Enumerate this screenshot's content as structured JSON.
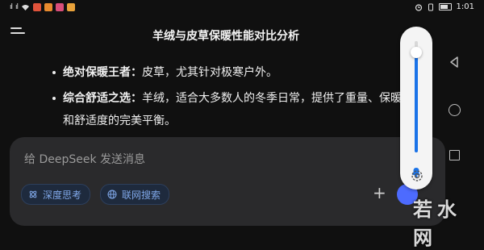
{
  "status_bar": {
    "time": "1:01",
    "signal": "ıl",
    "app_icon_colors": [
      "#e0533b",
      "#e88a2e",
      "#d94e7a",
      "#e9a23a"
    ]
  },
  "header": {
    "title": "羊绒与皮草保暖性能对比分析"
  },
  "content": {
    "bullets": [
      {
        "label": "绝对保暖王者：",
        "text": "皮草，尤其针对极寒户外。"
      },
      {
        "label": "综合舒适之选：",
        "text": "羊绒，适合大多数人的冬季日常，提供了重量、保暖和舒适度的完美平衡。"
      }
    ]
  },
  "composer": {
    "placeholder": "给 DeepSeek 发送消息",
    "deep_think_label": "深度思考",
    "web_search_label": "联网搜索"
  },
  "volume_panel": {
    "level_fraction": 0.9,
    "accent": "#1a73e8"
  },
  "watermark": {
    "text": "若水网"
  },
  "colors": {
    "background": "#101010",
    "composer_bg": "#2a2a2c",
    "chip_text": "#7fa7e8",
    "send_button": "#4d6bfe"
  }
}
